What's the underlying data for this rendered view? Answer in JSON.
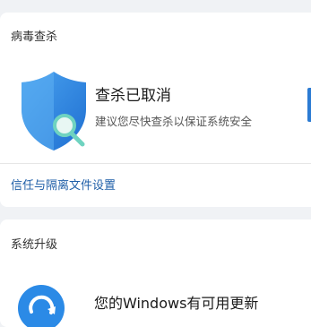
{
  "virus_scan": {
    "section_title": "病毒查杀",
    "status_title": "查杀已取消",
    "status_desc": "建议您尽快查杀以保证系统安全",
    "trust_link": "信任与隔离文件设置"
  },
  "system_upgrade": {
    "section_title": "系统升级",
    "update_text": "您的Windows有可用更新"
  },
  "icons": {
    "shield": "shield-search-icon",
    "refresh": "refresh-icon"
  },
  "colors": {
    "shield_blue": "#2e8be0",
    "magnifier_green": "#6fd3c0",
    "link_blue": "#1f5fa8",
    "accent_blue": "#2b7bd3"
  }
}
